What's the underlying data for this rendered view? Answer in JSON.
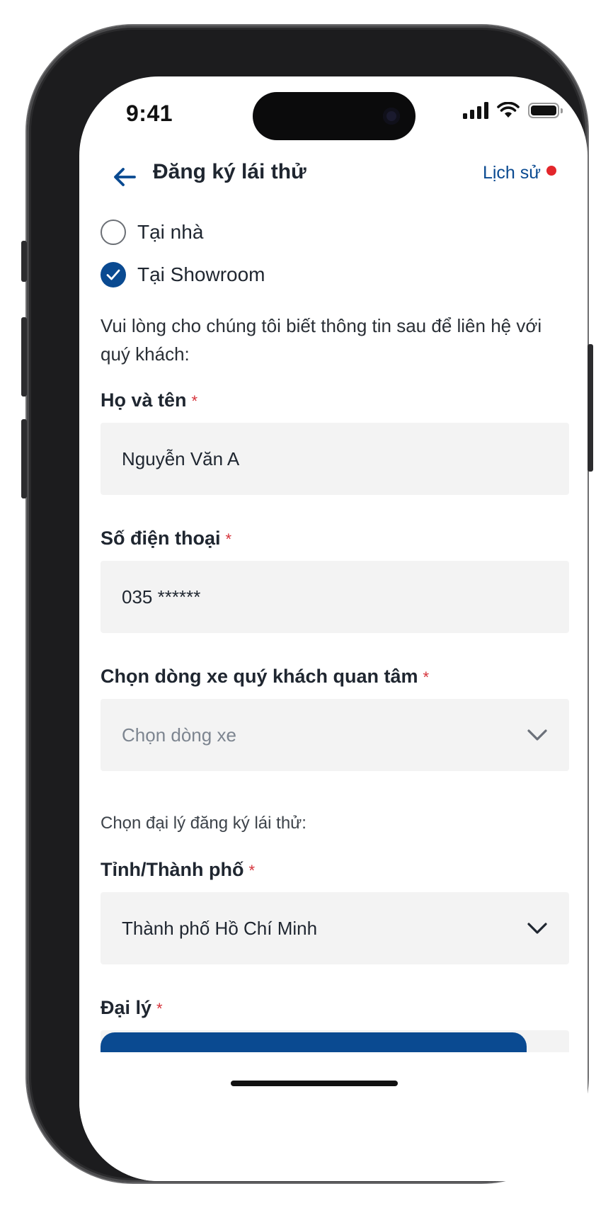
{
  "status": {
    "time": "9:41"
  },
  "header": {
    "title": "Đăng ký lái thử",
    "history": "Lịch sử"
  },
  "location_options": [
    {
      "label": "Tại nhà",
      "checked": false
    },
    {
      "label": "Tại Showroom",
      "checked": true
    }
  ],
  "intro": "Vui lòng cho chúng tôi biết thông tin sau để liên hệ với quý khách:",
  "fields": {
    "name": {
      "label": "Họ và tên",
      "value": "Nguyễn Văn A"
    },
    "phone": {
      "label": "Số điện thoại",
      "value": "035 ******"
    },
    "car": {
      "label": "Chọn dòng xe quý khách quan tâm",
      "placeholder": "Chọn dòng xe"
    },
    "dealer_section": "Chọn đại lý đăng ký lái thử:",
    "city": {
      "label": "Tỉnh/Thành phố",
      "value": "Thành phố Hồ Chí Minh"
    },
    "dealer": {
      "label": "Đại lý"
    }
  },
  "required_mark": "*",
  "colors": {
    "primary": "#0a4a91",
    "required": "#d6323a",
    "dot": "#e3262b",
    "field_bg": "#f3f3f3"
  }
}
